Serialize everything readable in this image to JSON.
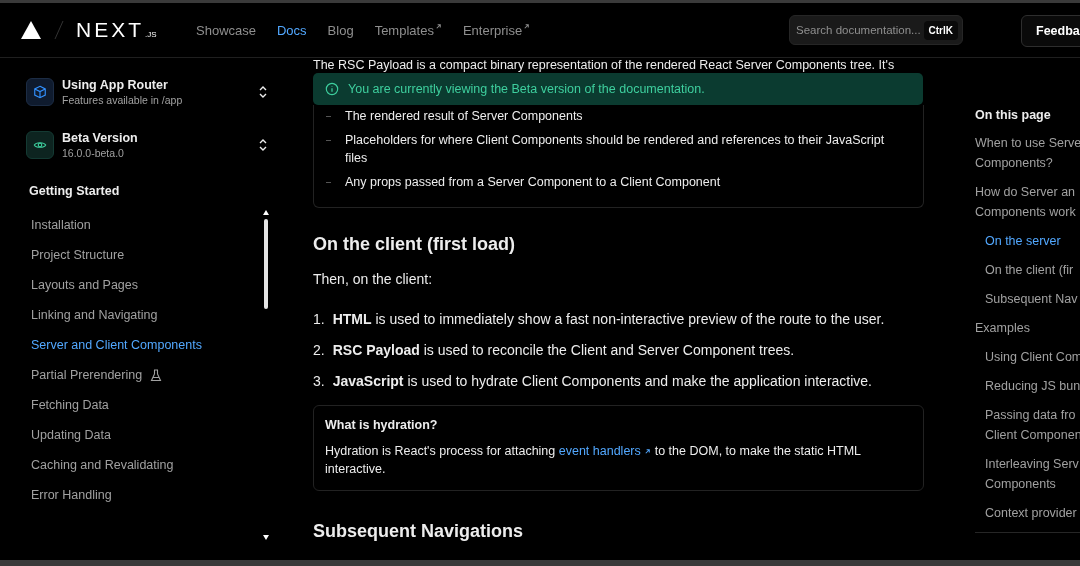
{
  "header": {
    "logo_suffix": ".JS",
    "logo_word": "NEXT",
    "nav": [
      {
        "label": "Showcase",
        "selected": false,
        "external": false
      },
      {
        "label": "Docs",
        "selected": true,
        "external": false
      },
      {
        "label": "Blog",
        "selected": false,
        "external": false
      },
      {
        "label": "Templates",
        "selected": false,
        "external": true
      },
      {
        "label": "Enterprise",
        "selected": false,
        "external": true
      }
    ],
    "search": {
      "placeholder": "Search documentation...",
      "shortcut": "CtrlK"
    },
    "feedback_button": "Feedba"
  },
  "sidebar": {
    "selectors": [
      {
        "kind": "router",
        "title": "Using App Router",
        "subtitle": "Features available in /app"
      },
      {
        "kind": "version",
        "title": "Beta Version",
        "subtitle": "16.0.0-beta.0"
      }
    ],
    "section_title": "Getting Started",
    "items": [
      {
        "label": "Installation",
        "selected": false,
        "experimental": false
      },
      {
        "label": "Project Structure",
        "selected": false,
        "experimental": false
      },
      {
        "label": "Layouts and Pages",
        "selected": false,
        "experimental": false
      },
      {
        "label": "Linking and Navigating",
        "selected": false,
        "experimental": false
      },
      {
        "label": "Server and Client Components",
        "selected": true,
        "experimental": false
      },
      {
        "label": "Partial Prerendering",
        "selected": false,
        "experimental": true
      },
      {
        "label": "Fetching Data",
        "selected": false,
        "experimental": false
      },
      {
        "label": "Updating Data",
        "selected": false,
        "experimental": false
      },
      {
        "label": "Caching and Revalidating",
        "selected": false,
        "experimental": false
      },
      {
        "label": "Error Handling",
        "selected": false,
        "experimental": false
      }
    ]
  },
  "content": {
    "intro_line": "The RSC Payload is a compact binary representation of the rendered React Server Components tree. It's",
    "banner": "You are currently viewing the Beta version of the documentation.",
    "payload_items": [
      "The rendered result of Server Components",
      "Placeholders for where Client Components should be rendered and references to their JavaScript files",
      "Any props passed from a Server Component to a Client Component"
    ],
    "heading": "On the client (first load)",
    "paragraph": "Then, on the client:",
    "steps": [
      {
        "number": "1.",
        "text": "**HTML** is used to immediately show a fast non-interactive preview of the route to the user."
      },
      {
        "number": "2.",
        "text": "**RSC Payload** is used to reconcile the Client and Server Component trees."
      },
      {
        "number": "3.",
        "text": "**JavaScript** is used to hydrate Client Components and make the application interactive."
      }
    ],
    "callout": {
      "title": "What is hydration?",
      "before": "Hydration is React's process for attaching ",
      "link": "event handlers",
      "after": " to the DOM, to make the static HTML interactive."
    },
    "next_heading": "Subsequent Navigations"
  },
  "toc": {
    "title": "On this page",
    "items": [
      {
        "lines": [
          "When to use Serve",
          "Components?"
        ],
        "selected": false
      },
      {
        "lines": [
          "How do Server an",
          "Components work"
        ],
        "selected": false,
        "children": [
          {
            "lines": [
              "On the server"
            ],
            "selected": true
          },
          {
            "lines": [
              "On the client (fir"
            ],
            "selected": false
          },
          {
            "lines": [
              "Subsequent Nav"
            ],
            "selected": false
          }
        ]
      },
      {
        "lines": [
          "Examples"
        ],
        "selected": false,
        "children": [
          {
            "lines": [
              "Using Client Com"
            ],
            "selected": false
          },
          {
            "lines": [
              "Reducing JS bun"
            ],
            "selected": false
          },
          {
            "lines": [
              "Passing data fro",
              "Client Componen"
            ],
            "selected": false
          },
          {
            "lines": [
              "Interleaving Serv",
              "Components"
            ],
            "selected": false
          },
          {
            "lines": [
              "Context provider"
            ],
            "selected": false
          }
        ]
      }
    ]
  }
}
